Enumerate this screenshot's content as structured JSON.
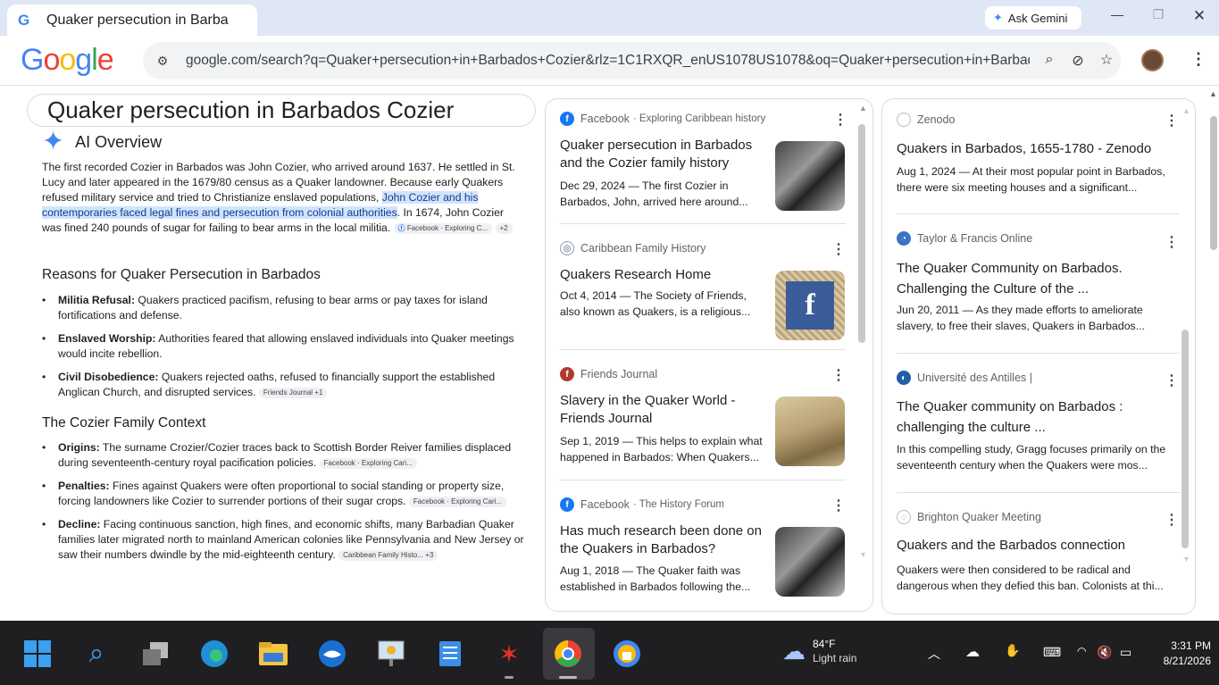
{
  "browser": {
    "tab_title": "Quaker persecution in Barba",
    "ask_gemini": "Ask Gemini",
    "url": "google.com/search?q=Quaker+persecution+in+Barbados+Cozier&rlz=1C1RXQR_enUS1078US1078&oq=Quaker+persecution+in+Barbados..."
  },
  "search": {
    "query": "Quaker persecution in Barbados Cozier"
  },
  "ai_overview": {
    "title": "AI Overview",
    "para_before": "The first recorded Cozier in Barbados was John Cozier, who arrived around 1637. He settled in St. Lucy and later appeared in the 1679/80 census as a Quaker landowner. Because early Quakers refused military service and tried to Christianize enslaved populations, ",
    "para_highlight": "John Cozier and his contemporaries faced legal fines and persecution from colonial authorities",
    "para_after": ". In 1674, John Cozier was fined 240 pounds of sugar for failing to bear arms in the local militia.",
    "para_chip": "Facebook · Exploring C...",
    "para_chip_count": "+2",
    "section1_title": "Reasons for Quaker Persecution in Barbados",
    "section1_items": [
      {
        "bold": "Militia Refusal:",
        "text": " Quakers practiced pacifism, refusing to bear arms or pay taxes for island fortifications and defense.",
        "chip": ""
      },
      {
        "bold": "Enslaved Worship:",
        "text": " Authorities feared that allowing enslaved individuals into Quaker meetings would incite rebellion.",
        "chip": ""
      },
      {
        "bold": "Civil Disobedience:",
        "text": " Quakers rejected oaths, refused to financially support the established Anglican Church, and disrupted services.",
        "chip": "Friends Journal +1"
      }
    ],
    "section2_title": "The Cozier Family Context",
    "section2_items": [
      {
        "bold": "Origins:",
        "text": " The surname Crozier/Cozier traces back to Scottish Border Reiver families displaced during seventeenth-century royal pacification policies.",
        "chip": "Facebook · Exploring Cari..."
      },
      {
        "bold": "Penalties:",
        "text": " Fines against Quakers were often proportional to social standing or property size, forcing landowners like Cozier to surrender portions of their sugar crops.",
        "chip": "Facebook · Exploring Cari..."
      },
      {
        "bold": "Decline:",
        "text": " Facing continuous sanction, high fines, and economic shifts, many Barbadian Quaker families later migrated north to mainland American colonies like Pennsylvania and New Jersey or saw their numbers dwindle by the mid-eighteenth century.",
        "chip": "Caribbean Family Histo... +3"
      }
    ]
  },
  "middle_sources": [
    {
      "source": "Facebook",
      "sub": "· Exploring Caribbean history",
      "title": "Quaker persecution in Barbados and the Cozier family history",
      "snippet": "Dec 29, 2024 — The first Cozier in Barbados, John, arrived here around...",
      "favicon_color": "#1877f2",
      "favicon_glyph": "f"
    },
    {
      "source": "Caribbean Family History",
      "sub": "",
      "title": "Quakers Research Home",
      "snippet": "Oct 4, 2014 — The Society of Friends, also known as Quakers, is a religious...",
      "favicon_color": "#8a9bb0",
      "favicon_glyph": "◎"
    },
    {
      "source": "Friends Journal",
      "sub": "",
      "title": "Slavery in the Quaker World - Friends Journal",
      "snippet": "Sep 1, 2019 — This helps to explain what happened in Barbados: When Quakers...",
      "favicon_color": "#b03a2e",
      "favicon_glyph": "f"
    },
    {
      "source": "Facebook",
      "sub": "· The History Forum",
      "title": "Has much research been done on the Quakers in Barbados?",
      "snippet": "Aug 1, 2018 — The Quaker faith was established in Barbados following the...",
      "favicon_color": "#1877f2",
      "favicon_glyph": "f"
    }
  ],
  "right_sources": [
    {
      "source": "Zenodo",
      "title": "Quakers in Barbados, 1655-1780 - Zenodo",
      "snippet": "Aug 1, 2024 — At their most popular point in Barbados, there were six meeting houses and a significant...",
      "favicon_color": "#ffffff",
      "favicon_glyph": ""
    },
    {
      "source": "Taylor & Francis Online",
      "title": "The Quaker Community on Barbados. Challenging the Culture of the ...",
      "snippet": "Jun 20, 2011 — As they made efforts to ameliorate slavery, to free their slaves, Quakers in Barbados...",
      "favicon_color": "#3a74c2",
      "favicon_glyph": "◔"
    },
    {
      "source": "Université des Antilles |",
      "title": "The Quaker community on Barbados : challenging the culture ...",
      "snippet": "In this compelling study, Gragg focuses primarily on the seventeenth century when the Quakers were mos...",
      "favicon_color": "#1f5fa8",
      "favicon_glyph": "◐"
    },
    {
      "source": "Brighton Quaker Meeting",
      "title": "Quakers and the Barbados connection",
      "snippet": "Quakers were then considered to be radical and dangerous when they defied this ban. Colonists at thi...",
      "favicon_color": "#ffffff",
      "favicon_glyph": "◌"
    }
  ],
  "taskbar": {
    "weather_temp": "84°F",
    "weather_desc": "Light rain",
    "time": "3:31 PM",
    "date": "8/21/2026"
  }
}
